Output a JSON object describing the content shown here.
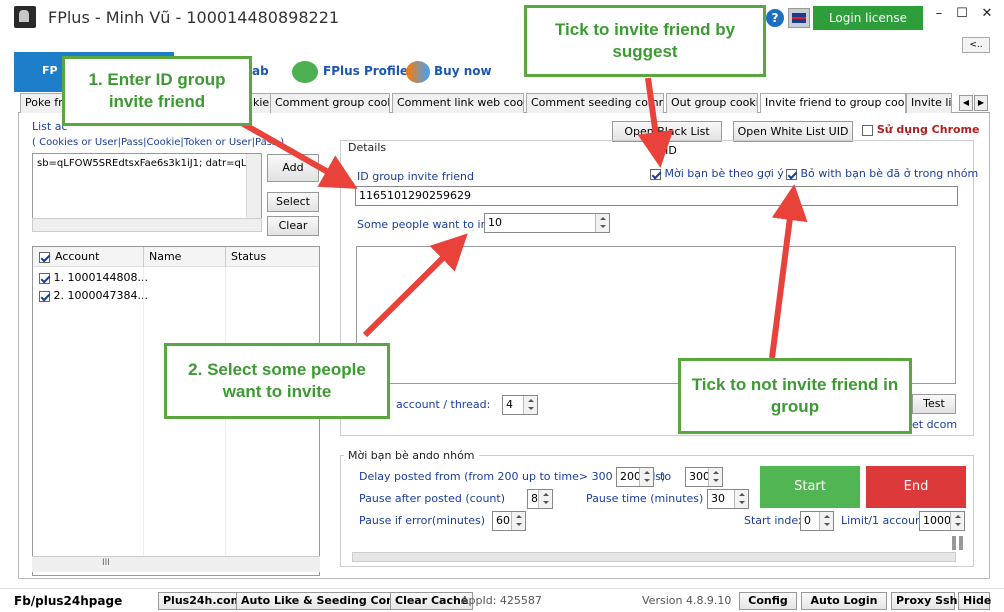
{
  "window": {
    "title": "FPlus - Minh Vũ - 100014480898221",
    "login_license": "Login license",
    "minimize": "–",
    "maximize": "☐",
    "close": "✕",
    "collapse": "<.."
  },
  "top_nav": {
    "fb_tab": "FP",
    "tab_partial": "ab",
    "profile": "FPlus Profile",
    "buy": "Buy now"
  },
  "tabs": [
    "Poke fri",
    "kie",
    "Comment group cookie",
    "Comment link web cookie",
    "Comment seeding comment",
    "Out group cookie",
    "Invite friend to group cookie",
    "Invite lik"
  ],
  "left": {
    "list_title": "List ac",
    "format_hint": "( Cookies or User|Pass|Cookie|Token or User|Pass )",
    "cookie_value": "sb=qLFOW5SREdtsxFae6s3k1iJ1; datr=qLFO",
    "add": "Add",
    "select": "Select",
    "clear": "Clear",
    "columns": [
      "Account",
      "Name",
      "Status"
    ],
    "rows": [
      {
        "account": "1. 1000144808..."
      },
      {
        "account": "2. 1000047384..."
      }
    ],
    "scroll_mark": "III"
  },
  "top_buttons": {
    "black_list": "Open Black List UID",
    "white_list": "Open White List UID",
    "chrome": "Sử dụng Chrome"
  },
  "details": {
    "legend": "Details",
    "id_label": "ID group invite friend",
    "id_value": "1165101290259629",
    "suggest_label": "Mời bạn bè theo gợi ý",
    "skip_label": "Bỏ with bạn bè đã ở trong nhóm",
    "people_label": "Some people want to invite",
    "people_value": "10",
    "thread_label": "account / thread:",
    "thread_value": "4",
    "test": "Test",
    "dcom": "et dcom"
  },
  "moi": {
    "legend": "Mời bạn bè ando nhóm",
    "delay_label": "Delay posted from (from 200 up to time> 300 seconds)",
    "delay_from": "200",
    "to": "to",
    "delay_to": "300",
    "pause_after_label": "Pause after posted (count)",
    "pause_after": "8",
    "pause_time_label": "Pause time (minutes)",
    "pause_time": "30",
    "pause_error_label": "Pause if error(minutes)",
    "pause_error": "60",
    "start_index_label": "Start index:",
    "start_index": "0",
    "limit_label": "Limit/1 account:",
    "limit": "1000",
    "start": "Start",
    "end": "End"
  },
  "status": {
    "page": "Fb/plus24hpage",
    "site": "Plus24h.com",
    "auto_like": "Auto Like & Seeding Com...",
    "clear_cache": "Clear Cache",
    "app_id": "AppId: 425587",
    "version": "Version 4.8.9.10",
    "config": "Config",
    "auto_login": "Auto Login",
    "proxy": "Proxy Ssh",
    "hide": "Hide"
  },
  "callouts": {
    "c1": "1. Enter ID group invite friend",
    "c2": "2. Select some people want to invite",
    "c3": "Tick to invite friend by suggest",
    "c4": "Tick to not invite friend in group"
  },
  "colors": {
    "green": "#2e9e3a",
    "callout_border": "#5aa63f",
    "arrow": "#e8423a",
    "start": "#52b553",
    "end": "#dc3a3a",
    "blue": "#1f7ec9"
  }
}
